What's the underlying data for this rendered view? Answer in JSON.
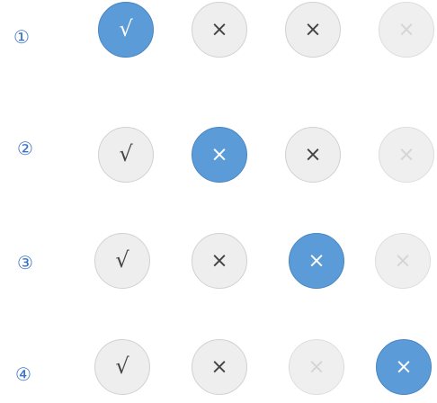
{
  "rows": [
    {
      "number": "①",
      "choices": [
        {
          "icon": "check-icon",
          "symbol": "√",
          "state": "selected"
        },
        {
          "icon": "close-icon",
          "symbol": "×",
          "state": "normal"
        },
        {
          "icon": "close-icon",
          "symbol": "×",
          "state": "normal"
        },
        {
          "icon": "close-icon",
          "symbol": "×",
          "state": "disabled"
        }
      ]
    },
    {
      "number": "②",
      "choices": [
        {
          "icon": "check-icon",
          "symbol": "√",
          "state": "normal"
        },
        {
          "icon": "close-icon",
          "symbol": "×",
          "state": "selected"
        },
        {
          "icon": "close-icon",
          "symbol": "×",
          "state": "normal"
        },
        {
          "icon": "close-icon",
          "symbol": "×",
          "state": "disabled"
        }
      ]
    },
    {
      "number": "③",
      "choices": [
        {
          "icon": "check-icon",
          "symbol": "√",
          "state": "normal"
        },
        {
          "icon": "close-icon",
          "symbol": "×",
          "state": "normal"
        },
        {
          "icon": "close-icon",
          "symbol": "×",
          "state": "selected"
        },
        {
          "icon": "close-icon",
          "symbol": "×",
          "state": "disabled"
        }
      ]
    },
    {
      "number": "④",
      "choices": [
        {
          "icon": "check-icon",
          "symbol": "√",
          "state": "normal"
        },
        {
          "icon": "close-icon",
          "symbol": "×",
          "state": "normal"
        },
        {
          "icon": "close-icon",
          "symbol": "×",
          "state": "disabled"
        },
        {
          "icon": "close-icon",
          "symbol": "×",
          "state": "selected"
        }
      ]
    }
  ],
  "colors": {
    "selected_fill": "#5b9bd8",
    "normal_fill": "#eeeeee",
    "disabled_fill": "#efefef",
    "number_color": "#3a73c7"
  }
}
